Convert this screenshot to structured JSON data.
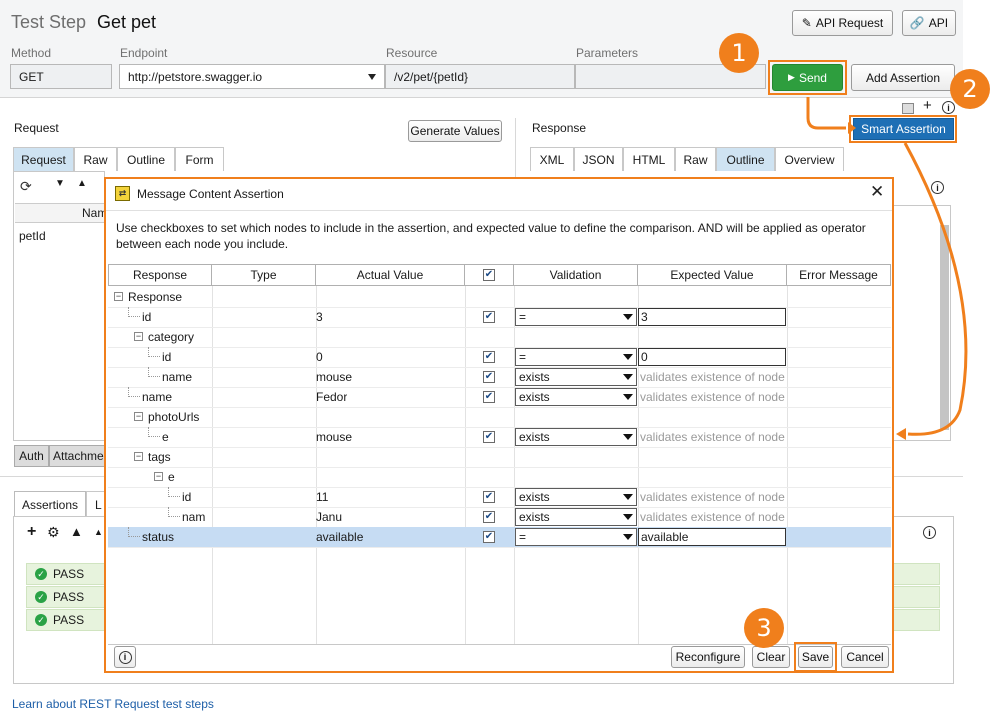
{
  "header": {
    "title_prefix": "Test Step",
    "title": "Get pet",
    "api_request_label": "API Request",
    "api_label": "API"
  },
  "request_bar": {
    "method_label": "Method",
    "endpoint_label": "Endpoint",
    "resource_label": "Resource",
    "parameters_label": "Parameters",
    "method_value": "GET",
    "endpoint_value": "http://petstore.swagger.io",
    "resource_value": "/v2/pet/{petId}",
    "parameters_value": "",
    "send_label": "Send",
    "add_assertion_label": "Add Assertion",
    "smart_assertion_label": "Smart Assertion"
  },
  "callouts": [
    "1",
    "2",
    "3"
  ],
  "request_panel": {
    "title": "Request",
    "generate_values_label": "Generate Values",
    "tabs": [
      "Request",
      "Raw",
      "Outline",
      "Form"
    ],
    "column_name": "Nam",
    "param_row": "petId",
    "bottom_tabs": [
      "Auth",
      "Attachme"
    ]
  },
  "response_panel": {
    "title": "Response",
    "tabs": [
      "XML",
      "JSON",
      "HTML",
      "Raw",
      "Outline",
      "Overview"
    ]
  },
  "assertions_panel": {
    "tabs": [
      "Assertions",
      "L"
    ],
    "results": [
      "PASS",
      "PASS",
      "PASS"
    ]
  },
  "footer_link": "Learn about REST Request test steps",
  "dialog": {
    "title": "Message Content Assertion",
    "description": "Use checkboxes to set which nodes to include in the assertion, and expected value to define the comparison. AND will be applied as operator between each node you include.",
    "columns": [
      "Response",
      "Type",
      "Actual Value",
      "",
      "Validation",
      "Expected Value",
      "Error Message"
    ],
    "header_checked": true,
    "rows": [
      {
        "node": "Response",
        "actual": "",
        "checked": null,
        "validation": "",
        "expected": "",
        "hint": ""
      },
      {
        "node": "id",
        "actual": "3",
        "checked": true,
        "validation": "=",
        "expected": "3",
        "hint": ""
      },
      {
        "node": "category",
        "actual": "",
        "checked": null,
        "validation": "",
        "expected": "",
        "hint": ""
      },
      {
        "node": "id",
        "actual": "0",
        "checked": true,
        "validation": "=",
        "expected": "0",
        "hint": ""
      },
      {
        "node": "name",
        "actual": "mouse",
        "checked": true,
        "validation": "exists",
        "expected": "",
        "hint": "validates existence of node"
      },
      {
        "node": "name",
        "actual": "Fedor",
        "checked": true,
        "validation": "exists",
        "expected": "",
        "hint": "validates existence of node"
      },
      {
        "node": "photoUrls",
        "actual": "",
        "checked": null,
        "validation": "",
        "expected": "",
        "hint": ""
      },
      {
        "node": "e",
        "actual": "mouse",
        "checked": true,
        "validation": "exists",
        "expected": "",
        "hint": "validates existence of node"
      },
      {
        "node": "tags",
        "actual": "",
        "checked": null,
        "validation": "",
        "expected": "",
        "hint": ""
      },
      {
        "node": "e",
        "actual": "",
        "checked": null,
        "validation": "",
        "expected": "",
        "hint": ""
      },
      {
        "node": "id",
        "actual": "11",
        "checked": true,
        "validation": "exists",
        "expected": "",
        "hint": "validates existence of node"
      },
      {
        "node": "nam",
        "actual": "Janu",
        "checked": true,
        "validation": "exists",
        "expected": "",
        "hint": "validates existence of node"
      },
      {
        "node": "status",
        "actual": "available",
        "checked": true,
        "validation": "=",
        "expected": "available",
        "hint": ""
      }
    ],
    "buttons": {
      "reconfigure": "Reconfigure",
      "clear": "Clear",
      "save": "Save",
      "cancel": "Cancel"
    }
  },
  "colors": {
    "accent_orange": "#f07f1c",
    "send_green": "#2e9e3e",
    "smart_blue": "#1e6fb5",
    "selected_row": "#c6dcf3",
    "active_tab": "#cfe3f2",
    "pass_green": "#e7f3dd"
  }
}
